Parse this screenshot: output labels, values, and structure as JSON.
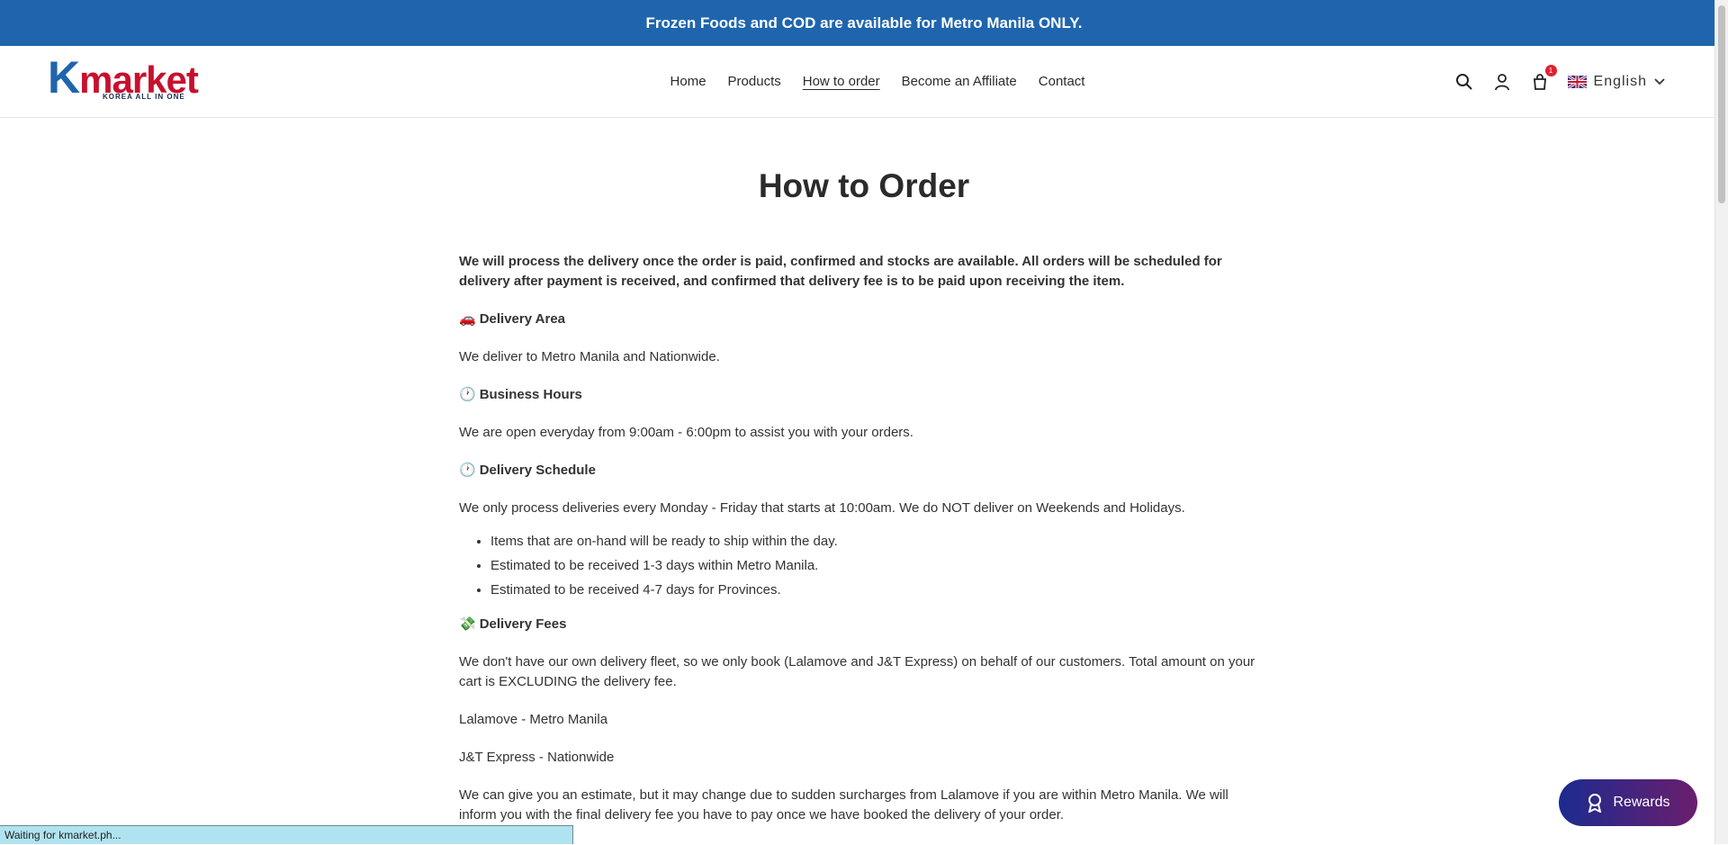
{
  "announcement": "Frozen Foods and COD are available for Metro Manila ONLY.",
  "logo": {
    "k": "K",
    "rest": "market",
    "tagline": "KOREA ALL IN ONE"
  },
  "nav": [
    {
      "label": "Home"
    },
    {
      "label": "Products"
    },
    {
      "label": "How to order",
      "active": true
    },
    {
      "label": "Become an Affiliate"
    },
    {
      "label": "Contact"
    }
  ],
  "cart": {
    "count": "1"
  },
  "language": {
    "label": "English"
  },
  "page": {
    "title": "How to Order",
    "lead": "We will process the delivery once the order is paid, confirmed and stocks are available. All orders will be scheduled for delivery after payment is received, and confirmed that delivery fee is to be paid upon receiving the item.",
    "delivery_area": {
      "emoji": "🚗",
      "title": "Delivery Area",
      "text": "We deliver to Metro Manila and Nationwide."
    },
    "business_hours": {
      "emoji": "🕐",
      "title": "Business Hours",
      "text": "We are open everyday from 9:00am - 6:00pm to assist you with your orders."
    },
    "delivery_schedule": {
      "emoji": "🕐",
      "title": "Delivery Schedule",
      "text": "We only process deliveries every Monday - Friday that starts at 10:00am. We do NOT deliver on Weekends and Holidays.",
      "items": [
        "Items that are on-hand will be ready to ship within the day.",
        "Estimated to be received 1-3 days within Metro Manila.",
        "Estimated to be received 4-7 days for Provinces."
      ]
    },
    "delivery_fees": {
      "emoji": "💸",
      "title": "Delivery Fees",
      "text": "We don't have our own delivery fleet, so we only book (Lalamove and J&T Express) on behalf of our customers. Total amount on your cart is EXCLUDING the delivery fee.",
      "lalamove": "Lalamove - Metro Manila",
      "jnt": "J&T Express - Nationwide",
      "estimate": "We can give you an estimate, but it may change due to sudden surcharges from Lalamove if you are within Metro Manila. We will inform you with the final delivery fee you have to pay once we have booked the delivery of your order."
    }
  },
  "rewards": {
    "label": "Rewards"
  },
  "status_bar": "Waiting for kmarket.ph...",
  "colors": {
    "announcement_bg": "#1f65ad",
    "brand_red": "#c8102e",
    "brand_blue": "#1f65ad",
    "rewards_gradient_start": "#1c2b8f",
    "rewards_gradient_end": "#6a1e6d"
  }
}
